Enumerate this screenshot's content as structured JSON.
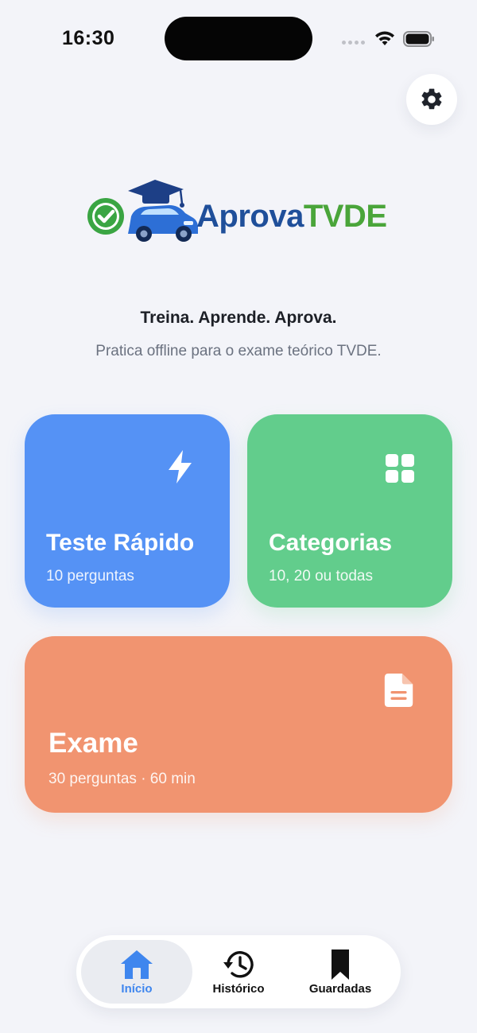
{
  "status_bar": {
    "time": "16:30"
  },
  "logo": {
    "text_part1": "Aprova",
    "text_part2": "TVDE"
  },
  "hero": {
    "tagline": "Treina. Aprende. Aprova.",
    "subtitle": "Pratica offline para o exame teórico TVDE."
  },
  "cards": {
    "quick_test": {
      "title": "Teste Rápido",
      "subtitle": "10 perguntas",
      "icon": "bolt-icon",
      "color": "#5592f5"
    },
    "categories": {
      "title": "Categorias",
      "subtitle": "10, 20 ou todas",
      "icon": "grid-icon",
      "color": "#62cd8c"
    },
    "exam": {
      "title": "Exame",
      "subtitle": "30 perguntas · 60 min",
      "icon": "document-icon",
      "color": "#f19470"
    }
  },
  "tab_bar": {
    "items": [
      {
        "label": "Início",
        "icon": "home-icon",
        "active": true
      },
      {
        "label": "Histórico",
        "icon": "history-icon",
        "active": false
      },
      {
        "label": "Guardadas",
        "icon": "bookmark-icon",
        "active": false
      }
    ],
    "active_color": "#3f86ee"
  },
  "settings": {
    "icon": "gear-icon"
  }
}
